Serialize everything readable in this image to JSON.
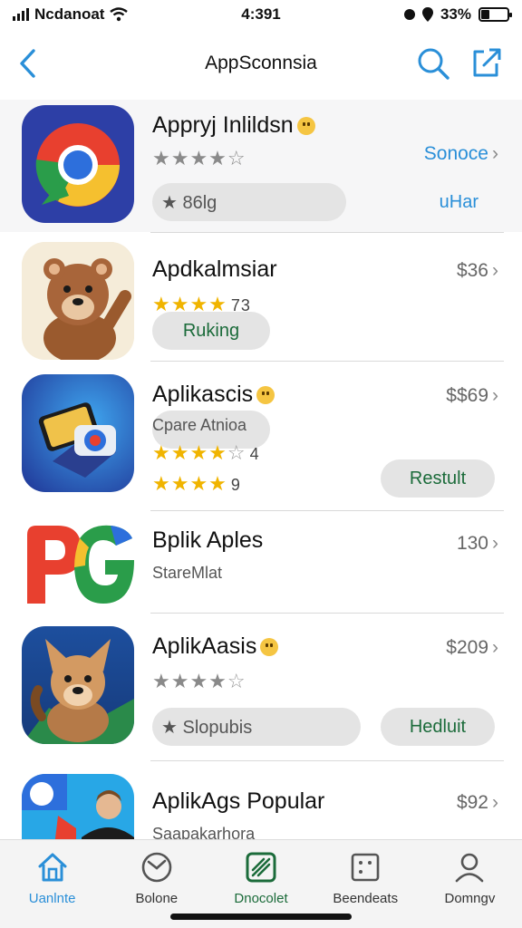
{
  "status_bar": {
    "carrier": "Ncdanoat",
    "time": "4:391",
    "battery": "33%",
    "battery_level": 0.33
  },
  "nav": {
    "title": "AppSconnsia",
    "back_icon": "chevron-left-icon",
    "search_icon": "search-icon",
    "share_icon": "share-icon"
  },
  "apps": [
    {
      "name": "Appryj Inlildsn",
      "rating_text": "★★★★☆",
      "action_link": "Sonoce",
      "pill_label": "★ 86lg",
      "side_label": "uHar"
    },
    {
      "name": "Apdkalmsiar",
      "rating_text": "★★★★",
      "rating_count": "73",
      "price": "$36",
      "pill_label": "Ruking"
    },
    {
      "name": "Aplikascis",
      "subtitle": "Cpare Atnioa",
      "rating_count": "4",
      "rating2_count": "9",
      "price": "$$69",
      "button_label": "Restult"
    },
    {
      "name": "Bplik Aples",
      "subtitle": "StareMlat",
      "price": "130"
    },
    {
      "name": "AplikAasis",
      "price": "$209",
      "pill_label": "★ Slopubis",
      "button_label": "Hedluit"
    },
    {
      "name": "AplikAgs Popular",
      "subtitle": "Saapakarhora",
      "price": "$92"
    }
  ],
  "tabs": [
    {
      "label": "Uanlnte",
      "icon": "home-icon"
    },
    {
      "label": "Bolone",
      "icon": "clock-icon"
    },
    {
      "label": "Dnocolet",
      "icon": "apps-icon"
    },
    {
      "label": "Beendeats",
      "icon": "grid-icon"
    },
    {
      "label": "Domngv",
      "icon": "person-icon"
    }
  ],
  "colors": {
    "accent_blue": "#2a8fd8",
    "star_gold": "#f0b400",
    "button_green_text": "#1b6b3a",
    "pill_gray": "#e4e4e4"
  }
}
